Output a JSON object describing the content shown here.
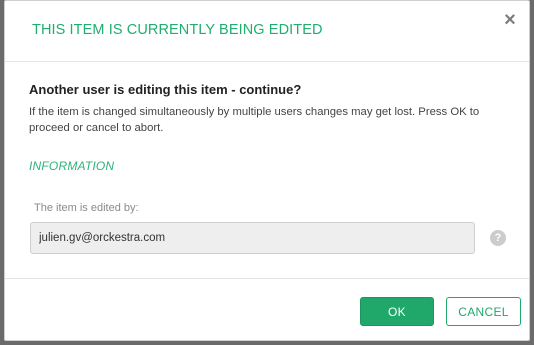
{
  "dialog": {
    "title": "THIS ITEM IS CURRENTLY BEING EDITED",
    "close_icon": "×",
    "question": "Another user is editing this item - continue?",
    "description": "If the item is changed simultaneously by multiple users changes may get lost. Press OK to proceed or cancel to abort.",
    "section_title": "INFORMATION",
    "field_label": "The item is edited by:",
    "field_value": "julien.gv@orckestra.com",
    "help_icon": "?",
    "ok_label": "OK",
    "cancel_label": "CANCEL"
  },
  "colors": {
    "accent": "#1fa86a",
    "title": "#1fae6e"
  }
}
